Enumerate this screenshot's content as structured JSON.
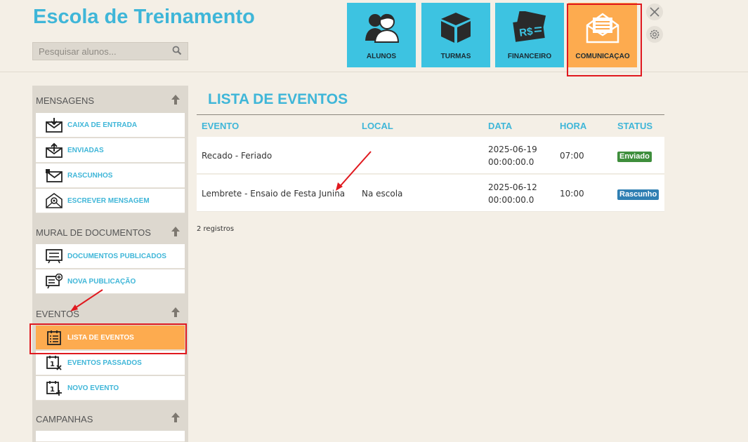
{
  "app": {
    "title": "Escola de Treinamento"
  },
  "search": {
    "placeholder": "Pesquisar alunos..."
  },
  "tiles": [
    {
      "label": "ALUNOS",
      "icon": "students-icon"
    },
    {
      "label": "TURMAS",
      "icon": "box-icon"
    },
    {
      "label": "FINANCEIRO",
      "icon": "money-icon"
    },
    {
      "label": "COMUNICAÇAO",
      "icon": "envelope-open-icon",
      "active": true
    }
  ],
  "sidebar": {
    "sections": [
      {
        "title": "MENSAGENS",
        "items": [
          {
            "label": "CAIXA DE ENTRADA",
            "icon": "inbox-icon"
          },
          {
            "label": "ENVIADAS",
            "icon": "sent-icon"
          },
          {
            "label": "RASCUNHOS",
            "icon": "draft-icon"
          },
          {
            "label": "ESCREVER MENSAGEM",
            "icon": "compose-mail-icon"
          }
        ]
      },
      {
        "title": "MURAL DE DOCUMENTOS",
        "items": [
          {
            "label": "DOCUMENTOS PUBLICADOS",
            "icon": "board-list-icon"
          },
          {
            "label": "NOVA PUBLICAÇÃO",
            "icon": "board-add-icon"
          }
        ]
      },
      {
        "title": "EVENTOS",
        "items": [
          {
            "label": "LISTA DE EVENTOS",
            "icon": "calendar-list-icon",
            "active": true
          },
          {
            "label": "EVENTOS PASSADOS",
            "icon": "calendar-x-icon"
          },
          {
            "label": "NOVO EVENTO",
            "icon": "calendar-add-icon"
          }
        ]
      },
      {
        "title": "CAMPANHAS",
        "items": []
      }
    ]
  },
  "main": {
    "title": "LISTA DE EVENTOS",
    "columns": [
      "EVENTO",
      "LOCAL",
      "DATA",
      "HORA",
      "STATUS"
    ],
    "rows": [
      {
        "evento": "Recado - Feriado",
        "local": "",
        "data_line1": "2025-06-19",
        "data_line2": "00:00:00.0",
        "hora": "07:00",
        "status": "Enviado"
      },
      {
        "evento": "Lembrete - Ensaio de Festa Junina",
        "local": "Na escola",
        "data_line1": "2025-06-12",
        "data_line2": "00:00:00.0",
        "hora": "10:00",
        "status": "Rascunho"
      }
    ],
    "record_count": "2 registros"
  },
  "colors": {
    "accent": "#3fb6d8",
    "tile": "#3dc3e1",
    "active": "#fdab4f",
    "status_enviado": "#3e8e3c",
    "status_rascunho": "#2f7fb3",
    "annotation": "#e0191f"
  }
}
